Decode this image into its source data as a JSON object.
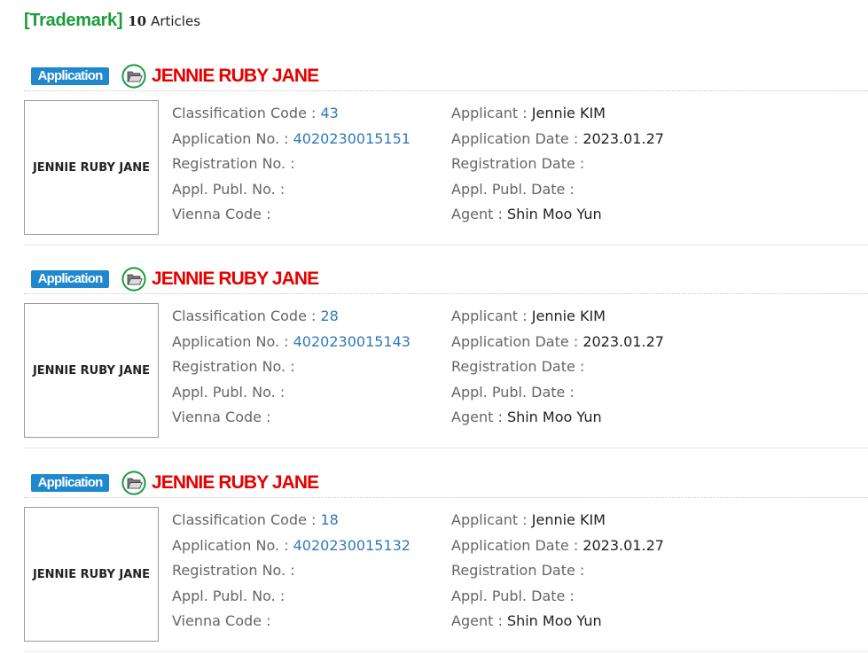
{
  "header": {
    "title": "[Trademark]",
    "count": "10",
    "count_suffix": "Articles",
    "title_color": "#1a9c3c"
  },
  "labels": {
    "classification_code": "Classification Code",
    "application_no": "Application No.",
    "registration_no": "Registration No.",
    "appl_publ_no": "Appl. Publ. No.",
    "vienna_code": "Vienna Code",
    "applicant": "Applicant",
    "application_date": "Application Date",
    "registration_date": "Registration Date",
    "appl_publ_date": "Appl. Publ. Date",
    "agent": "Agent",
    "separator": ":"
  },
  "colors": {
    "status_badge": "#1f88cf",
    "title_red": "#e60000",
    "link_blue": "#2f7ab8",
    "icon_green": "#1a9c3c"
  },
  "articles": [
    {
      "status": "Application",
      "status_icon": "folder-open-icon",
      "title": "JENNIE RUBY JANE",
      "thumbnail_text": "JENNIE RUBY JANE",
      "classification_code": "43",
      "application_no": "4020230015151",
      "registration_no": "",
      "appl_publ_no": "",
      "vienna_code": "",
      "applicant": "Jennie KIM",
      "application_date": "2023.01.27",
      "registration_date": "",
      "appl_publ_date": "",
      "agent": "Shin Moo Yun"
    },
    {
      "status": "Application",
      "status_icon": "folder-open-icon",
      "title": "JENNIE RUBY JANE",
      "thumbnail_text": "JENNIE RUBY JANE",
      "classification_code": "28",
      "application_no": "4020230015143",
      "registration_no": "",
      "appl_publ_no": "",
      "vienna_code": "",
      "applicant": "Jennie KIM",
      "application_date": "2023.01.27",
      "registration_date": "",
      "appl_publ_date": "",
      "agent": "Shin Moo Yun"
    },
    {
      "status": "Application",
      "status_icon": "folder-open-icon",
      "title": "JENNIE RUBY JANE",
      "thumbnail_text": "JENNIE RUBY JANE",
      "classification_code": "18",
      "application_no": "4020230015132",
      "registration_no": "",
      "appl_publ_no": "",
      "vienna_code": "",
      "applicant": "Jennie KIM",
      "application_date": "2023.01.27",
      "registration_date": "",
      "appl_publ_date": "",
      "agent": "Shin Moo Yun"
    }
  ]
}
